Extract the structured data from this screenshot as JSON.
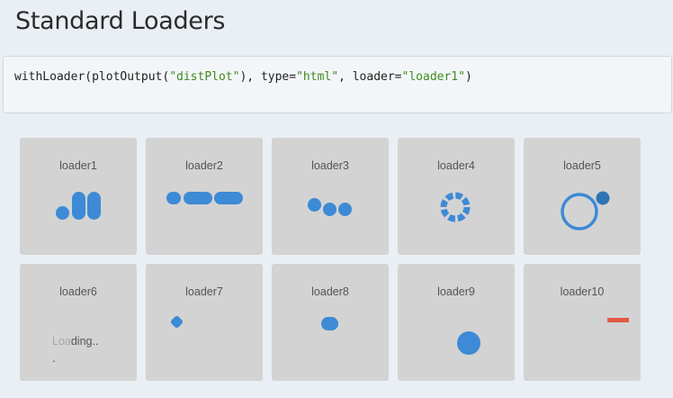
{
  "page": {
    "title": "Standard Loaders"
  },
  "code": {
    "prefix": "withLoader(plotOutput(",
    "arg1": "\"distPlot\"",
    "mid1": "), type=",
    "type_value": "\"html\"",
    "mid2": ", loader=",
    "loader_value": "\"loader1\"",
    "suffix": ")"
  },
  "loaders": [
    {
      "label": "loader1"
    },
    {
      "label": "loader2"
    },
    {
      "label": "loader3"
    },
    {
      "label": "loader4"
    },
    {
      "label": "loader5"
    },
    {
      "label": "loader6"
    },
    {
      "label": "loader7"
    },
    {
      "label": "loader8"
    },
    {
      "label": "loader9"
    },
    {
      "label": "loader10"
    }
  ],
  "loader6_text": {
    "faded": "Loa",
    "visible": "ding..",
    "dot": "."
  },
  "colors": {
    "loader_blue": "#3d8ad6",
    "loader10_red": "#e05a47",
    "tile_bg": "#d3d3d3"
  }
}
